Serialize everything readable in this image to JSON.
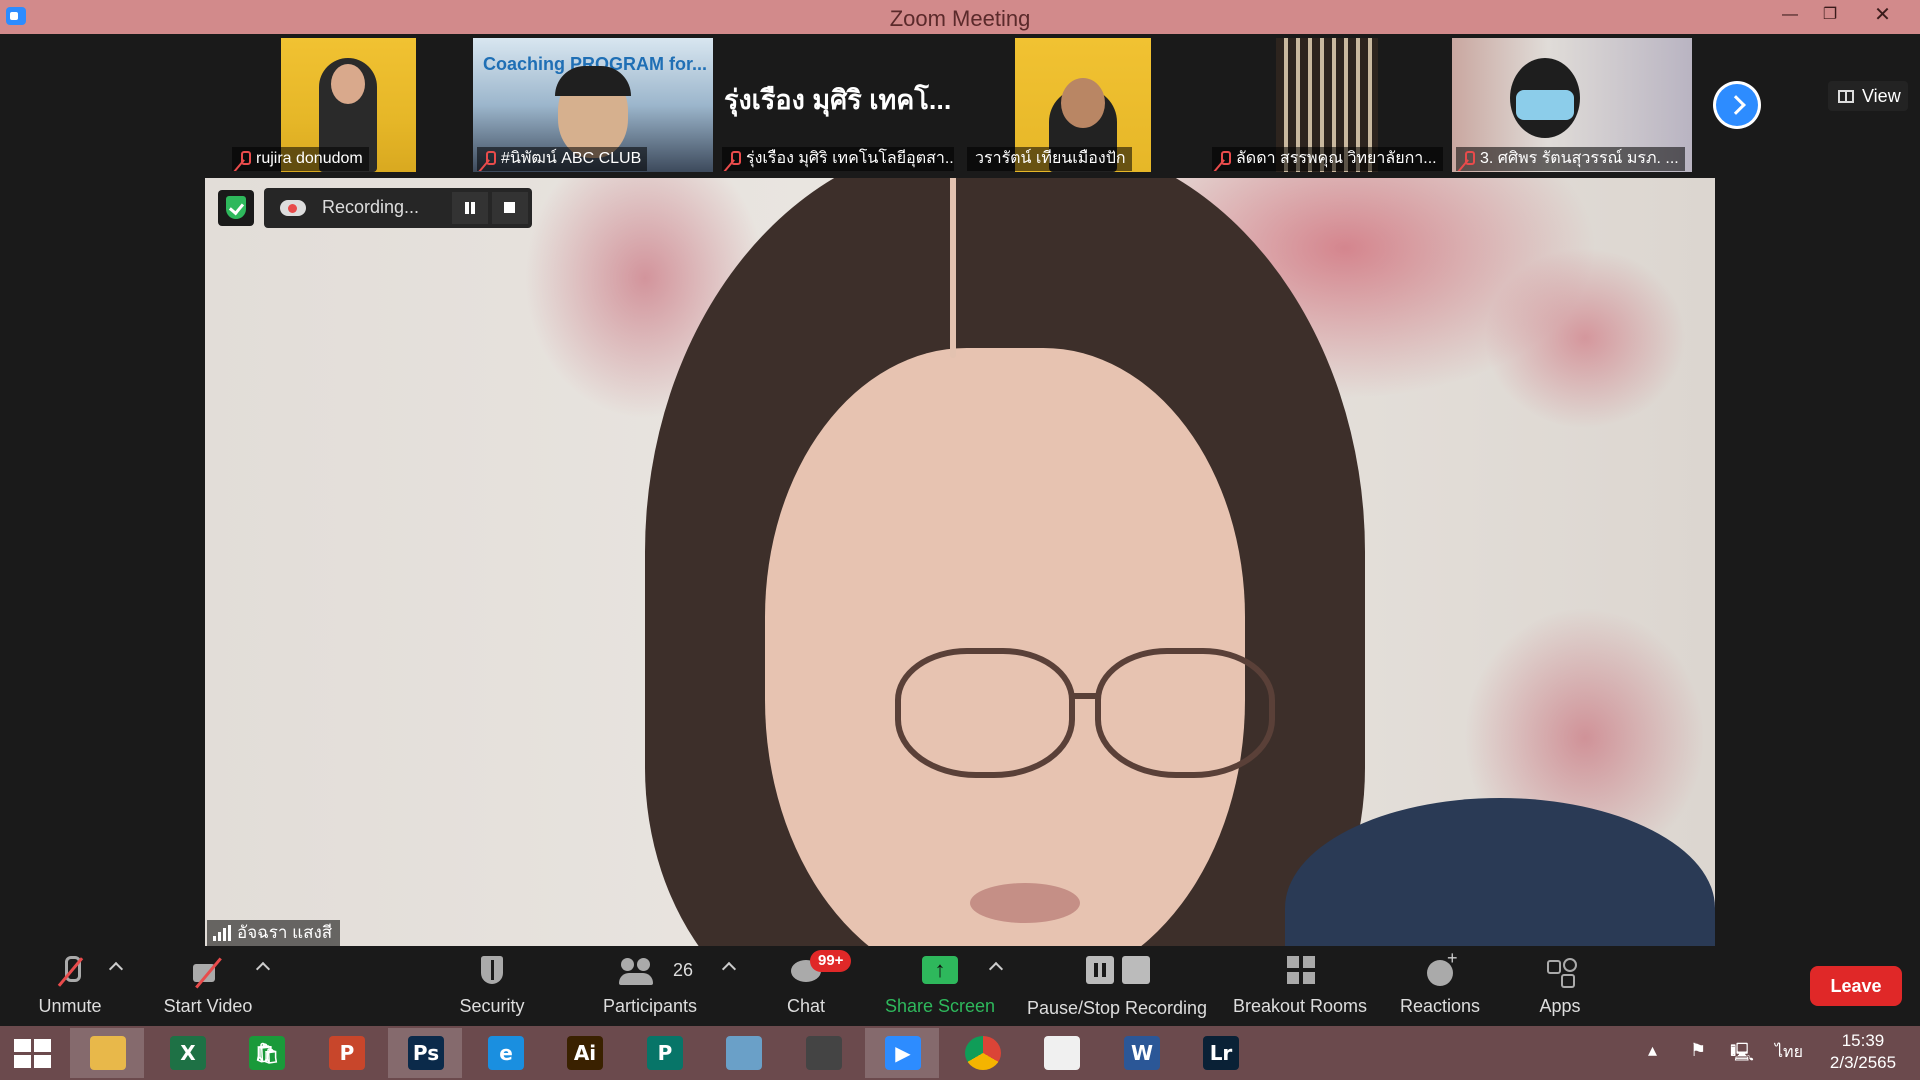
{
  "window": {
    "title": "Zoom Meeting"
  },
  "gallery": {
    "tiles": [
      {
        "name": "rujira donudom",
        "muted": true
      },
      {
        "name": "#นิพัฒน์ ABC CLUB",
        "muted": true,
        "overlay_text": "Coaching PROGRAM for..."
      },
      {
        "name": "รุ่งเรือง มุศิริ เทคโนโลยีอุตสา...",
        "muted": true,
        "big_name": "รุ่งเรือง มุศิริ เทคโ..."
      },
      {
        "name": "วรารัตน์ เทียนเมืองปัก",
        "muted": false
      },
      {
        "name": "ลัดดา สรรพคุณ วิทยาลัยกา...",
        "muted": true
      },
      {
        "name": "3. ศศิพร รัตนสุวรรณ์ มรภ. ...",
        "muted": true
      }
    ],
    "view_label": "View"
  },
  "recording": {
    "label": "Recording..."
  },
  "speaker": {
    "name": "อัจฉรา แสงสี"
  },
  "controls": {
    "unmute": "Unmute",
    "start_video": "Start Video",
    "security": "Security",
    "participants": "Participants",
    "participants_count": "26",
    "chat": "Chat",
    "chat_badge": "99+",
    "share_screen": "Share Screen",
    "pause_stop_recording": "Pause/Stop Recording",
    "breakout_rooms": "Breakout Rooms",
    "reactions": "Reactions",
    "apps": "Apps",
    "leave": "Leave"
  },
  "taskbar": {
    "apps": [
      {
        "icon": "file-explorer-icon",
        "glyph": "",
        "color": "#e8b84a"
      },
      {
        "icon": "excel-icon",
        "glyph": "X",
        "color": "#1e7145"
      },
      {
        "icon": "store-icon",
        "glyph": "🛍",
        "color": "#1a9a3a"
      },
      {
        "icon": "powerpoint-icon",
        "glyph": "P",
        "color": "#c8462b"
      },
      {
        "icon": "photoshop-icon",
        "glyph": "Ps",
        "color": "#0b2a4a"
      },
      {
        "icon": "internet-explorer-icon",
        "glyph": "e",
        "color": "#1a8fe0"
      },
      {
        "icon": "illustrator-icon",
        "glyph": "Ai",
        "color": "#3a2100"
      },
      {
        "icon": "publisher-icon",
        "glyph": "P",
        "color": "#077568"
      },
      {
        "icon": "app-icon",
        "glyph": "",
        "color": "#6aa0c8"
      },
      {
        "icon": "photoscape-icon",
        "glyph": "",
        "color": "#444444"
      },
      {
        "icon": "zoom-icon",
        "glyph": "▶",
        "color": "#2d8cff"
      },
      {
        "icon": "chrome-icon",
        "glyph": "",
        "color": "#e8e8e8"
      },
      {
        "icon": "photo-app-icon",
        "glyph": "",
        "color": "#f0f0f0"
      },
      {
        "icon": "word-icon",
        "glyph": "W",
        "color": "#2b5797"
      },
      {
        "icon": "lightroom-icon",
        "glyph": "Lr",
        "color": "#0a2136"
      }
    ],
    "language": "ไทย",
    "time": "15:39",
    "date": "2/3/2565"
  }
}
